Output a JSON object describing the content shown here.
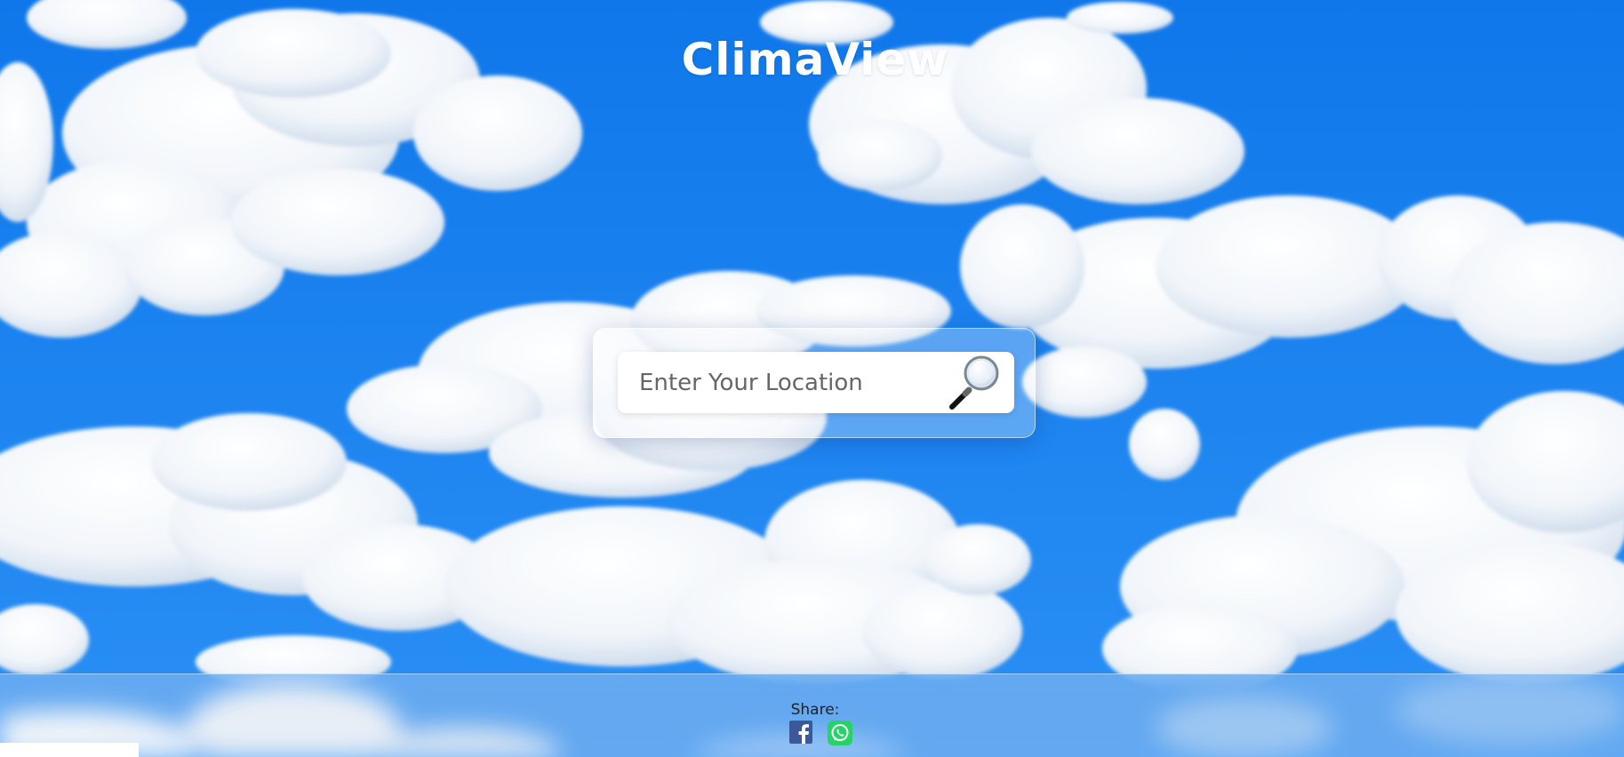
{
  "app": {
    "title": "ClimaView"
  },
  "search": {
    "placeholder": "Enter Your Location",
    "value": "",
    "button_icon": "magnifying-glass-icon"
  },
  "footer": {
    "share_label": "Share:",
    "share_icons": [
      "facebook-icon",
      "whatsapp-icon"
    ]
  },
  "colors": {
    "sky": "#1c86f2",
    "facebook": "#3b5998",
    "whatsapp": "#25d366"
  }
}
